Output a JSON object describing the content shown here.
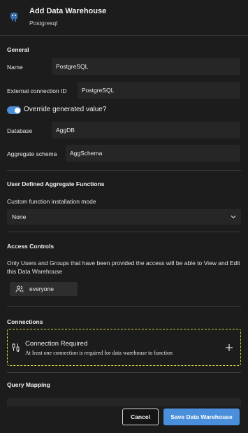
{
  "header": {
    "title": "Add Data Warehouse",
    "subtitle": "Postgresql",
    "logo_icon": "postgresql-elephant-icon"
  },
  "general": {
    "section_title": "General",
    "name_label": "Name",
    "name_value": "PostgreSQL",
    "external_id_label": "External connection ID",
    "external_id_value": "PostgreSQL",
    "override_label": "Override generated value?",
    "override_enabled": true,
    "database_label": "Database",
    "database_value": "AggDB",
    "aggregate_schema_label": "Aggregate schema",
    "aggregate_schema_value": "AggSchema"
  },
  "udaf": {
    "section_title": "User Defined Aggregate Functions",
    "mode_label": "Custom function installation mode",
    "mode_value": "None"
  },
  "access": {
    "section_title": "Access Controls",
    "description": "Only Users and Groups that have been provided the access will be able to View and Edit this Data Warehouse",
    "chip_label": "everyone",
    "chip_icon": "users-icon"
  },
  "connections": {
    "section_title": "Connections",
    "box_title": "Connection Required",
    "box_subtitle": "At least one connection is required for data warehouse to function",
    "icon": "plug-icon",
    "add_icon": "plus-icon"
  },
  "query_mapping": {
    "section_title": "Query Mapping"
  },
  "footer": {
    "cancel_label": "Cancel",
    "save_label": "Save Data Warehouse"
  },
  "colors": {
    "background": "#1c1c1c",
    "field": "#262626",
    "accent": "#4a8fdc",
    "dashed_border": "#d4d43a"
  }
}
